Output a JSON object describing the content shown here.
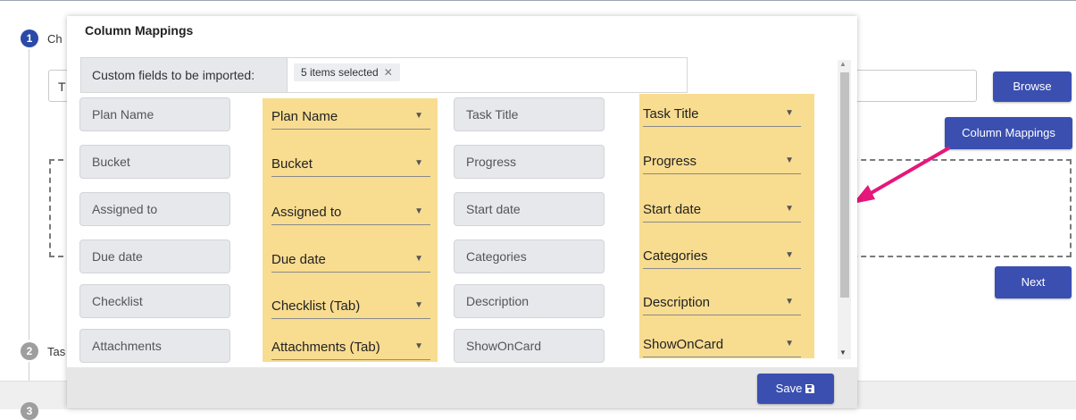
{
  "background": {
    "steps": [
      {
        "number": "1",
        "label": "Ch"
      },
      {
        "number": "2",
        "label": "Tas"
      },
      {
        "number": "3",
        "label": ""
      }
    ],
    "file_input_value": "T",
    "browse_label": "Browse",
    "column_mappings_label": "Column Mappings",
    "next_label": "Next"
  },
  "dialog": {
    "title": "Column Mappings",
    "custom_fields_label": "Custom fields to be imported:",
    "custom_fields_chip": "5 items selected",
    "chip_remove": "✕",
    "left_mappings": [
      {
        "field": "Plan Name",
        "value": "Plan Name"
      },
      {
        "field": "Bucket",
        "value": "Bucket"
      },
      {
        "field": "Assigned to",
        "value": "Assigned to"
      },
      {
        "field": "Due date",
        "value": "Due date"
      },
      {
        "field": "Checklist",
        "value": "Checklist (Tab)"
      },
      {
        "field": "Attachments",
        "value": "Attachments (Tab)"
      }
    ],
    "right_mappings": [
      {
        "field": "Task Title",
        "value": "Task Title"
      },
      {
        "field": "Progress",
        "value": "Progress"
      },
      {
        "field": "Start date",
        "value": "Start date"
      },
      {
        "field": "Categories",
        "value": "Categories"
      },
      {
        "field": "Description",
        "value": "Description"
      },
      {
        "field": "ShowOnCard",
        "value": "ShowOnCard"
      }
    ],
    "save_label": "Save"
  },
  "colors": {
    "accent": "#3a4fb0",
    "highlight": "#f8dc90",
    "arrow": "#e6177a"
  },
  "icons": [
    "save-icon",
    "chevron-down-icon",
    "close-icon",
    "scroll-up-icon",
    "scroll-down-icon"
  ]
}
